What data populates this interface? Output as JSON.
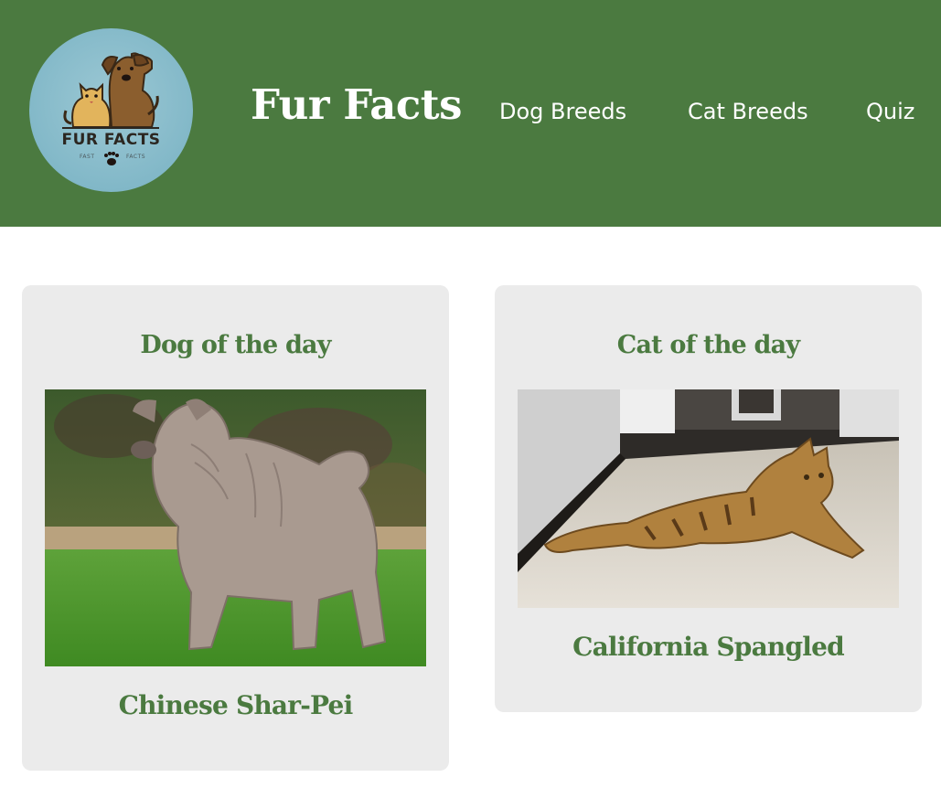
{
  "header": {
    "logo": {
      "text": "FUR FACTS",
      "sub_left": "FAST",
      "sub_right": "FACTS",
      "background_color": "#82b8c8"
    },
    "title": "Fur Facts",
    "background_color": "#4b7a40",
    "nav": [
      {
        "label": "Dog Breeds"
      },
      {
        "label": "Cat Breeds"
      },
      {
        "label": "Quiz"
      }
    ]
  },
  "main": {
    "cards": [
      {
        "title": "Dog of the day",
        "breed": "Chinese Shar-Pei",
        "photo_icon": "shar-pei-photo"
      },
      {
        "title": "Cat of the day",
        "breed": "California Spangled",
        "photo_icon": "spangled-cat-photo"
      }
    ],
    "accent_color": "#4b7a40",
    "card_color": "#ebebeb"
  }
}
